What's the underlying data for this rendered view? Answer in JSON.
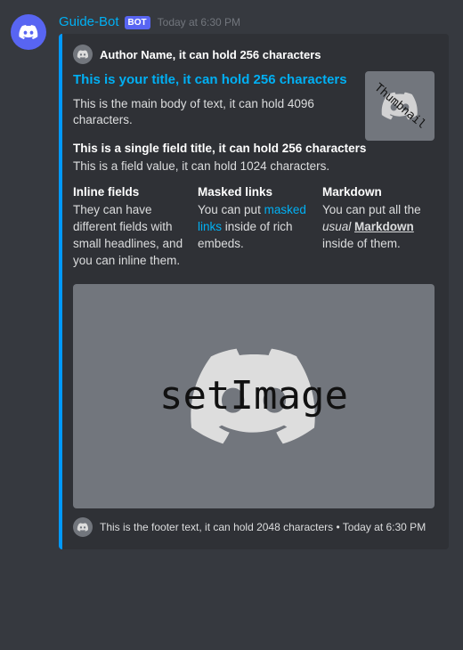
{
  "message": {
    "username": "Guide-Bot",
    "bot_badge": "BOT",
    "timestamp": "Today at 6:30 PM"
  },
  "embed": {
    "accent_color": "#0099ff",
    "author": {
      "name": "Author Name, it can hold 256 characters"
    },
    "title": "This is your title, it can hold 256 characters",
    "description": "This is the main body of text, it can hold 4096 characters.",
    "thumbnail_label": "Thumbnail",
    "single_field": {
      "title": "This is a single field title, it can hold 256 characters",
      "value": "This is a field value, it can hold 1024 characters."
    },
    "inline_fields": [
      {
        "title": "Inline fields",
        "value_plain": "They can have different fields with small headlines, and you can inline them."
      },
      {
        "title": "Masked links",
        "value_pre": "You can put ",
        "value_link": "masked links",
        "value_post": " inside of rich embeds."
      },
      {
        "title": "Markdown",
        "value_pre": "You can put all the ",
        "value_italic": "usual",
        "value_sp": " ",
        "value_boldu": "Markdown",
        "value_post": " inside of them."
      }
    ],
    "image_label": "setImage",
    "footer": {
      "text": "This is the footer text, it can hold 2048 characters",
      "sep": " • ",
      "timestamp": "Today at 6:30 PM"
    }
  }
}
